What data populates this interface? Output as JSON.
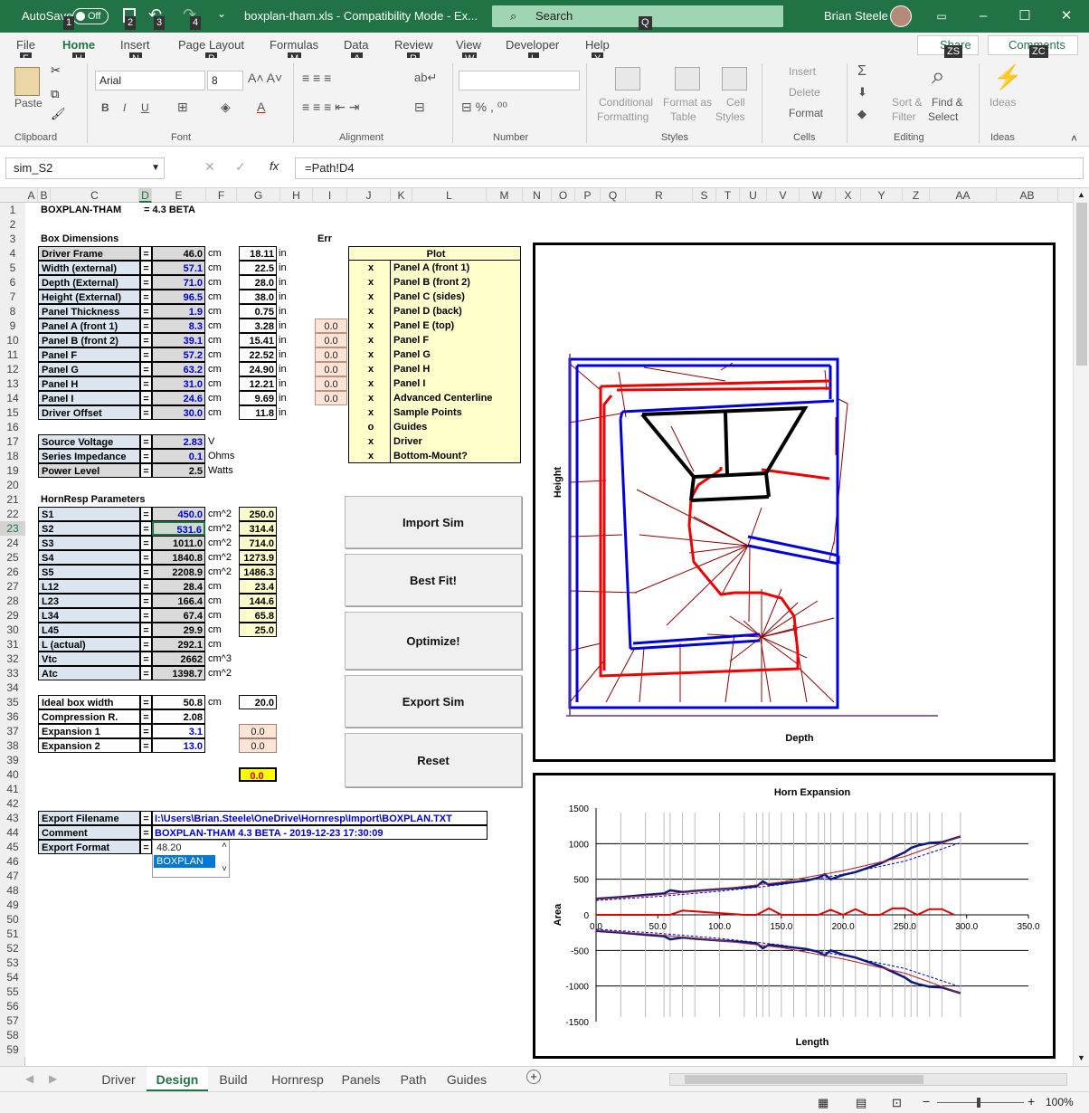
{
  "titlebar": {
    "autosave": "AutoSave",
    "autosave_state": "Off",
    "filename": "boxplan-tham.xls  -  Compatibility Mode  -  Ex...",
    "search_placeholder": "Search",
    "user": "Brian Steele",
    "keytips": [
      "1",
      "2",
      "3",
      "4",
      "Q"
    ]
  },
  "ribbon_tabs": [
    {
      "label": "File",
      "key": "F"
    },
    {
      "label": "Home",
      "key": "H"
    },
    {
      "label": "Insert",
      "key": "N"
    },
    {
      "label": "Page Layout",
      "key": "P"
    },
    {
      "label": "Formulas",
      "key": "M"
    },
    {
      "label": "Data",
      "key": "A"
    },
    {
      "label": "Review",
      "key": "R"
    },
    {
      "label": "View",
      "key": "W"
    },
    {
      "label": "Developer",
      "key": "L"
    },
    {
      "label": "Help",
      "key": "Y"
    }
  ],
  "share": "Share",
  "share_key": "ZS",
  "comments": "Comments",
  "comments_key": "ZC",
  "ribbon": {
    "paste": "Paste",
    "font_name": "Arial",
    "font_size": "8",
    "cond_fmt": [
      "Conditional",
      "Formatting"
    ],
    "format_table": [
      "Format as",
      "Table"
    ],
    "cell_styles": [
      "Cell",
      "Styles"
    ],
    "insert": "Insert",
    "delete": "Delete",
    "format": "Format",
    "sort": [
      "Sort &",
      "Filter"
    ],
    "find": [
      "Find &",
      "Select"
    ],
    "ideas": "Ideas",
    "groups": [
      "Clipboard",
      "Font",
      "Alignment",
      "Number",
      "Styles",
      "Cells",
      "Editing",
      "Ideas"
    ]
  },
  "formula_bar": {
    "name_box": "sim_S2",
    "formula": "=Path!D4"
  },
  "columns": [
    "A",
    "B",
    "C",
    "D",
    "E",
    "F",
    "G",
    "H",
    "I",
    "J",
    "K",
    "L",
    "M",
    "N",
    "O",
    "P",
    "Q",
    "R",
    "S",
    "T",
    "U",
    "V",
    "W",
    "X",
    "Y",
    "Z",
    "AA",
    "AB"
  ],
  "rows": [
    "1",
    "2",
    "3",
    "4",
    "5",
    "6",
    "7",
    "8",
    "9",
    "10",
    "11",
    "12",
    "13",
    "14",
    "15",
    "16",
    "17",
    "18",
    "19",
    "20",
    "21",
    "22",
    "23",
    "24",
    "25",
    "26",
    "27",
    "28",
    "29",
    "30",
    "31",
    "32",
    "33",
    "34",
    "35",
    "36",
    "37",
    "38",
    "39",
    "40",
    "41",
    "42",
    "43",
    "44",
    "45",
    "46",
    "47",
    "48",
    "49",
    "50",
    "51",
    "52",
    "53",
    "54",
    "55",
    "56",
    "57",
    "58",
    "59"
  ],
  "header": {
    "title": "BOXPLAN-THAM",
    "version": "=  4.3 BETA",
    "err": "Err"
  },
  "box_dims": {
    "title": "Box Dimensions",
    "rows": [
      {
        "label": "Driver Frame",
        "cm": "46.0",
        "in": "18.11",
        "gray": true
      },
      {
        "label": "Width (external)",
        "cm": "57.1",
        "in": "22.5",
        "gray": false
      },
      {
        "label": "Depth (External)",
        "cm": "71.0",
        "in": "28.0",
        "gray": false
      },
      {
        "label": "Height (External)",
        "cm": "96.5",
        "in": "38.0",
        "gray": false
      },
      {
        "label": "Panel Thickness",
        "cm": "1.9",
        "in": "0.75",
        "gray": false
      },
      {
        "label": "Panel A (front 1)",
        "cm": "8.3",
        "in": "3.28",
        "gray": false,
        "err": "0.0"
      },
      {
        "label": "Panel B (front 2)",
        "cm": "39.1",
        "in": "15.41",
        "gray": false,
        "err": "0.0"
      },
      {
        "label": "Panel F",
        "cm": "57.2",
        "in": "22.52",
        "gray": false,
        "err": "0.0"
      },
      {
        "label": "Panel G",
        "cm": "63.2",
        "in": "24.90",
        "gray": false,
        "err": "0.0"
      },
      {
        "label": "Panel H",
        "cm": "31.0",
        "in": "12.21",
        "gray": false,
        "err": "0.0"
      },
      {
        "label": "Panel I",
        "cm": "24.6",
        "in": "9.69",
        "gray": false,
        "err": "0.0"
      },
      {
        "label": "Driver Offset",
        "cm": "30.0",
        "in": "11.8",
        "gray": false
      }
    ],
    "unit_cm": "cm",
    "unit_in": "in"
  },
  "plot_table": {
    "title": "Plot",
    "items": [
      {
        "mark": "x",
        "label": "Panel A (front 1)"
      },
      {
        "mark": "x",
        "label": "Panel B (front 2)"
      },
      {
        "mark": "x",
        "label": "Panel C (sides)"
      },
      {
        "mark": "x",
        "label": "Panel D (back)"
      },
      {
        "mark": "x",
        "label": "Panel E (top)"
      },
      {
        "mark": "x",
        "label": "Panel F"
      },
      {
        "mark": "x",
        "label": "Panel G"
      },
      {
        "mark": "x",
        "label": "Panel H"
      },
      {
        "mark": "x",
        "label": "Panel I"
      },
      {
        "mark": "x",
        "label": "Advanced Centerline"
      },
      {
        "mark": "x",
        "label": "Sample Points"
      },
      {
        "mark": "o",
        "label": "Guides"
      },
      {
        "mark": "x",
        "label": "Driver"
      },
      {
        "mark": "x",
        "label": "Bottom-Mount?"
      }
    ]
  },
  "electrical": [
    {
      "label": "Source Voltage",
      "value": "2.83",
      "unit": "V",
      "gray": false
    },
    {
      "label": "Series Impedance",
      "value": "0.1",
      "unit": "Ohms",
      "gray": false
    },
    {
      "label": "Power Level",
      "value": "2.5",
      "unit": "Watts",
      "gray": true
    }
  ],
  "hornresp": {
    "title": "HornResp Parameters",
    "rows": [
      {
        "label": "S1",
        "value": "450.0",
        "unit": "cm^2",
        "sim": "250.0",
        "blue": true
      },
      {
        "label": "S2",
        "value": "531.6",
        "unit": "cm^2",
        "sim": "314.4",
        "blue": true
      },
      {
        "label": "S3",
        "value": "1011.0",
        "unit": "cm^2",
        "sim": "714.0",
        "blue": false
      },
      {
        "label": "S4",
        "value": "1840.8",
        "unit": "cm^2",
        "sim": "1273.9",
        "blue": false
      },
      {
        "label": "S5",
        "value": "2208.9",
        "unit": "cm^2",
        "sim": "1486.3",
        "blue": false
      },
      {
        "label": "L12",
        "value": "28.4",
        "unit": "cm",
        "sim": "23.4",
        "blue": false
      },
      {
        "label": "L23",
        "value": "166.4",
        "unit": "cm",
        "sim": "144.6",
        "blue": false
      },
      {
        "label": "L34",
        "value": "67.4",
        "unit": "cm",
        "sim": "65.8",
        "blue": false
      },
      {
        "label": "L45",
        "value": "29.9",
        "unit": "cm",
        "sim": "25.0",
        "blue": false
      },
      {
        "label": "L (actual)",
        "value": "292.1",
        "unit": "cm",
        "sim": null,
        "blue": false
      },
      {
        "label": "Vtc",
        "value": "2662",
        "unit": "cm^3",
        "sim": null,
        "blue": false
      },
      {
        "label": "Atc",
        "value": "1398.7",
        "unit": "cm^2",
        "sim": null,
        "blue": false
      }
    ]
  },
  "box_width": [
    {
      "label": "Ideal box width",
      "value": "50.8",
      "unit": "cm",
      "extra": "20.0",
      "blue": false
    },
    {
      "label": "Compression R.",
      "value": "2.08",
      "unit": "",
      "extra": null,
      "blue": false
    },
    {
      "label": "Expansion 1",
      "value": "3.1",
      "unit": "",
      "extra": "0.0",
      "blue": true
    },
    {
      "label": "Expansion 2",
      "value": "13.0",
      "unit": "",
      "extra": "0.0",
      "blue": true
    }
  ],
  "total_err": "0.0",
  "export": {
    "filename_label": "Export Filename",
    "filename": "I:\\Users\\Brian.Steele\\OneDrive\\Hornresp\\Import\\BOXPLAN.TXT",
    "comment_label": "Comment",
    "comment": "BOXPLAN-THAM 4.3 BETA - 2019-12-23 17:30:09",
    "format_label": "Export Format",
    "dropdown": [
      "48.20",
      "BOXPLAN"
    ]
  },
  "buttons": [
    "Import Sim",
    "Best Fit!",
    "Optimize!",
    "Export Sim",
    "Reset"
  ],
  "box_plot": {
    "xlabel": "Depth",
    "ylabel": "Height"
  },
  "chart_data": {
    "type": "line",
    "title": "Horn Expansion",
    "xlabel": "Length",
    "ylabel": "Area",
    "xlim": [
      0,
      350
    ],
    "ylim": [
      -1500,
      1500
    ],
    "xticks": [
      "0.0",
      "50.0",
      "100.0",
      "150.0",
      "200.0",
      "250.0",
      "300.0",
      "350.0"
    ],
    "yticks": [
      "1500",
      "1000",
      "500",
      "0",
      "-500",
      "-1000",
      "-1500"
    ],
    "series": [
      {
        "color": "#0a1a80",
        "x": [
          0,
          20,
          40,
          55,
          60,
          70,
          80,
          100,
          120,
          130,
          135,
          140,
          150,
          160,
          170,
          180,
          185,
          190,
          200,
          210,
          220,
          230,
          240,
          250,
          255,
          260,
          270,
          280,
          295
        ],
        "values": [
          225,
          250,
          280,
          300,
          345,
          320,
          335,
          360,
          385,
          400,
          470,
          420,
          440,
          460,
          480,
          520,
          570,
          500,
          560,
          600,
          660,
          720,
          800,
          880,
          940,
          970,
          1010,
          1020,
          1100
        ]
      },
      {
        "color": "#e00000",
        "x": [
          0,
          50,
          100,
          150,
          200,
          250,
          295
        ],
        "values": [
          220,
          280,
          360,
          460,
          620,
          820,
          1100
        ]
      },
      {
        "color": "#e00000",
        "x": [
          0,
          60,
          70,
          120,
          130,
          140,
          150,
          180,
          190,
          200,
          210,
          220,
          230,
          240,
          250,
          260,
          270,
          280,
          290
        ],
        "values": [
          0,
          0,
          60,
          0,
          0,
          90,
          0,
          0,
          70,
          0,
          80,
          0,
          0,
          90,
          90,
          0,
          80,
          80,
          0
        ]
      }
    ]
  },
  "sheet_tabs": [
    "Driver",
    "Design",
    "Build",
    "Hornresp",
    "Panels",
    "Path",
    "Guides"
  ],
  "active_tab": "Design",
  "zoom": "100%"
}
